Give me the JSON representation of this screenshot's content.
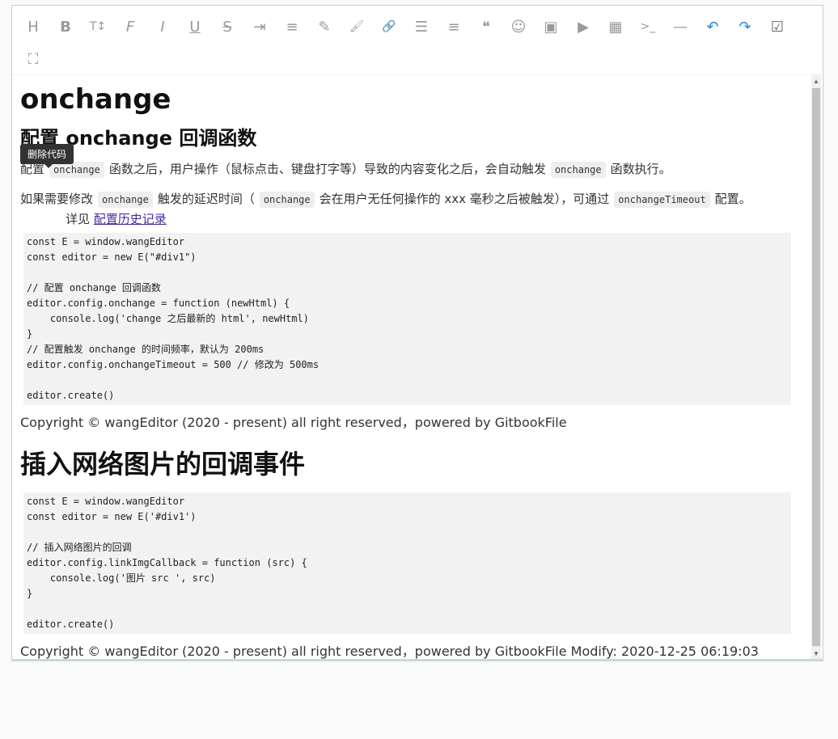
{
  "toolbar": {
    "row1": [
      {
        "name": "head-icon",
        "glyph": "H"
      },
      {
        "name": "bold-icon",
        "glyph": "B"
      },
      {
        "name": "font-size-icon",
        "glyph": "T↕"
      },
      {
        "name": "font-family-icon",
        "glyph": "F"
      },
      {
        "name": "italic-icon",
        "glyph": "I"
      },
      {
        "name": "underline-icon",
        "glyph": "U"
      },
      {
        "name": "strikethrough-icon",
        "glyph": "S"
      },
      {
        "name": "indent-icon",
        "glyph": "⇥"
      },
      {
        "name": "line-height-icon",
        "glyph": "≡"
      },
      {
        "name": "fore-color-icon",
        "glyph": "✎"
      },
      {
        "name": "back-color-icon",
        "glyph": "🖌"
      },
      {
        "name": "link-icon",
        "glyph": "🔗"
      },
      {
        "name": "list-icon",
        "glyph": "☰"
      },
      {
        "name": "justify-icon",
        "glyph": "≡"
      },
      {
        "name": "quote-icon",
        "glyph": "❝"
      },
      {
        "name": "emoticon-icon",
        "glyph": "☺"
      },
      {
        "name": "image-icon",
        "glyph": "▣"
      },
      {
        "name": "video-icon",
        "glyph": "▶"
      },
      {
        "name": "table-icon",
        "glyph": "▦"
      },
      {
        "name": "code-icon",
        "glyph": ">_"
      },
      {
        "name": "splitline-icon",
        "glyph": "—"
      },
      {
        "name": "undo-icon",
        "glyph": "↶"
      },
      {
        "name": "redo-icon",
        "glyph": "↷"
      },
      {
        "name": "todo-icon",
        "glyph": "☑"
      }
    ],
    "row2": [
      {
        "name": "fullscreen-icon",
        "glyph": "⛶"
      }
    ]
  },
  "content": {
    "title": "onchange",
    "subtitle": "配置 onchange 回调函数",
    "p1_a": "配置",
    "p1_code1": "onchange",
    "p1_b": "函数之后，用户操作（鼠标点击、键盘打字等）导致的内容变化之后，会自动触发",
    "p1_code2": "onchange",
    "p1_c": "函数执行。",
    "p2_a": "如果需要修改",
    "p2_code1": "onchange",
    "p2_b": "触发的延迟时间（",
    "p2_code2": "onchange",
    "p2_c": "会在用户无任何操作的 xxx 毫秒之后被触发），可通过",
    "p2_code3": "onchangeTimeout",
    "p2_d": "配置。",
    "p3_a": "详见",
    "p3_link": "配置历史记录",
    "tooltip": "删除代码",
    "code1": "const E = window.wangEditor\nconst editor = new E(\"#div1\")\n\n// 配置 onchange 回调函数\neditor.config.onchange = function (newHtml) {\n    console.log('change 之后最新的 html', newHtml)\n}\n// 配置触发 onchange 的时间频率，默认为 200ms\neditor.config.onchangeTimeout = 500 // 修改为 500ms\n\neditor.create()",
    "copyright1": "Copyright © wangEditor (2020 - present) all right reserved，powered by GitbookFile",
    "heading2": "插入网络图片的回调事件",
    "code2": "const E = window.wangEditor\nconst editor = new E('#div1')\n\n// 插入网络图片的回调\neditor.config.linkImgCallback = function (src) {\n    console.log('图片 src ', src)\n}\n\neditor.create()",
    "copyright2": "Copyright © wangEditor (2020 - present) all right reserved，powered by GitbookFile Modify: 2020-12-25 06:19:03"
  }
}
